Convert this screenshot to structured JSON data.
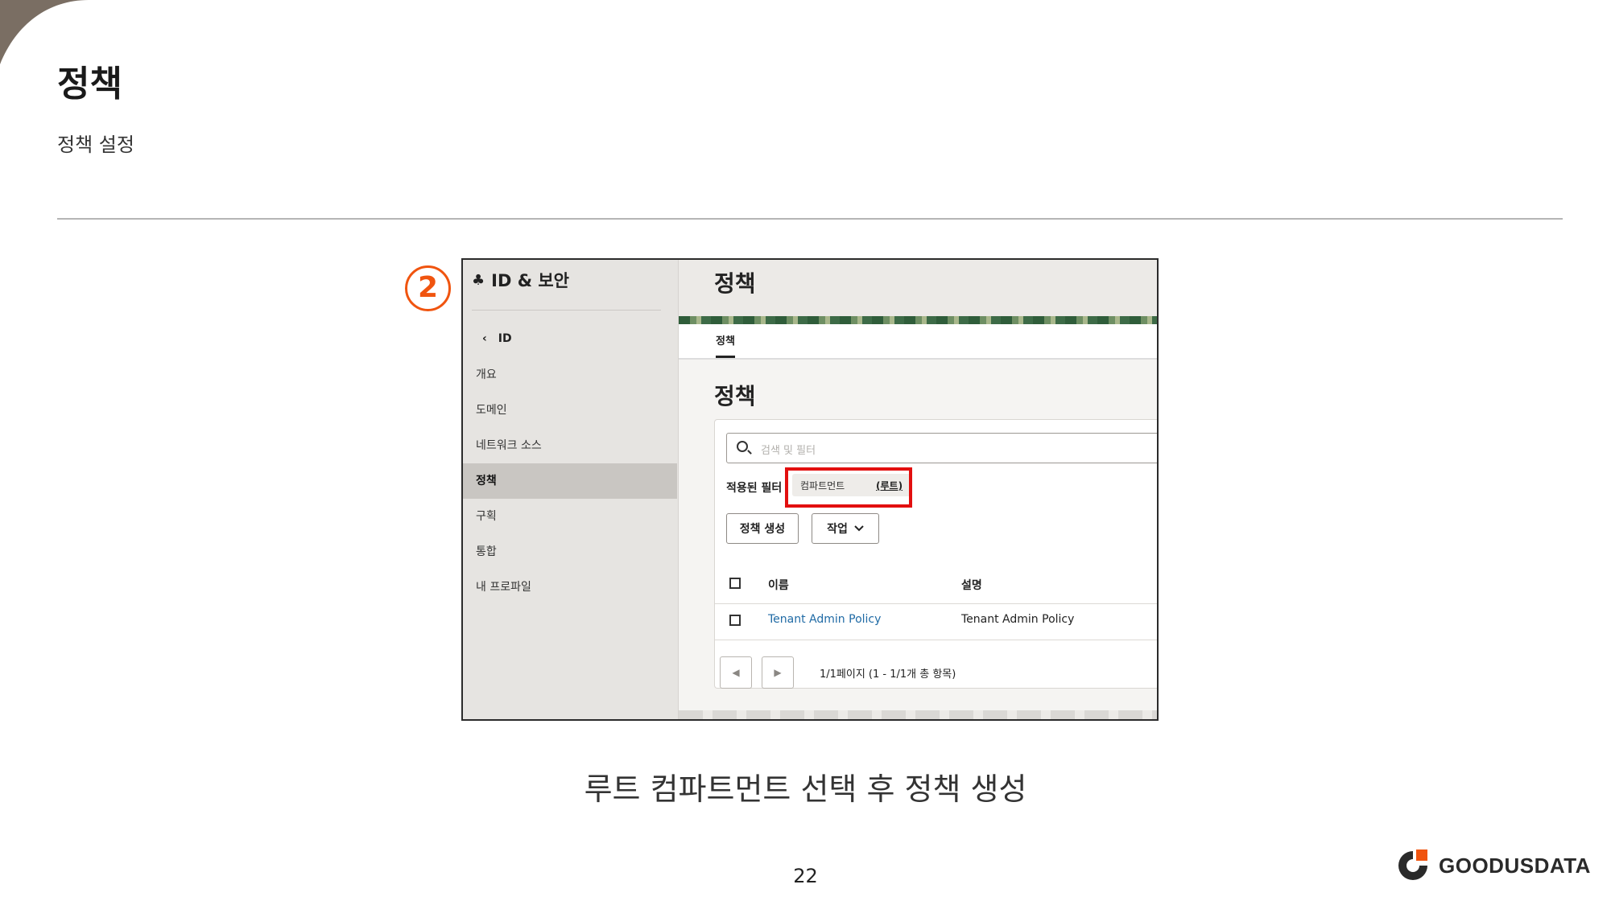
{
  "slide": {
    "title": "정책",
    "subtitle": "정책 설정",
    "step_number": "2",
    "caption": "루트 컴파트먼트 선택 후 정책 생성",
    "page_number": "22",
    "logo_text": "GOODUSDATA",
    "accent_color": "#f0540f",
    "highlight_color": "#e20f0f"
  },
  "screenshot": {
    "sidebar": {
      "header": "ID & 보안",
      "header_icon": "people-icon",
      "back_label": "ID",
      "items": [
        {
          "label": "개요"
        },
        {
          "label": "도메인"
        },
        {
          "label": "네트워크 소스"
        },
        {
          "label": "정책",
          "active": true
        },
        {
          "label": "구획"
        },
        {
          "label": "통합"
        },
        {
          "label": "내 프로파일"
        }
      ]
    },
    "main": {
      "top_title": "정책",
      "tab": "정책",
      "page_heading": "정책",
      "search_placeholder": "검색 및 필터",
      "applied_filter_label": "적용된 필터",
      "filter_key": "컴파트먼트",
      "filter_value": "(루트)",
      "create_button": "정책 생성",
      "action_button": "작업",
      "columns": [
        "이름",
        "설명"
      ],
      "rows": [
        {
          "name": "Tenant Admin Policy",
          "description": "Tenant Admin Policy"
        }
      ],
      "pagination": "1/1페이지 (1 - 1/1개 총 항목)"
    }
  }
}
